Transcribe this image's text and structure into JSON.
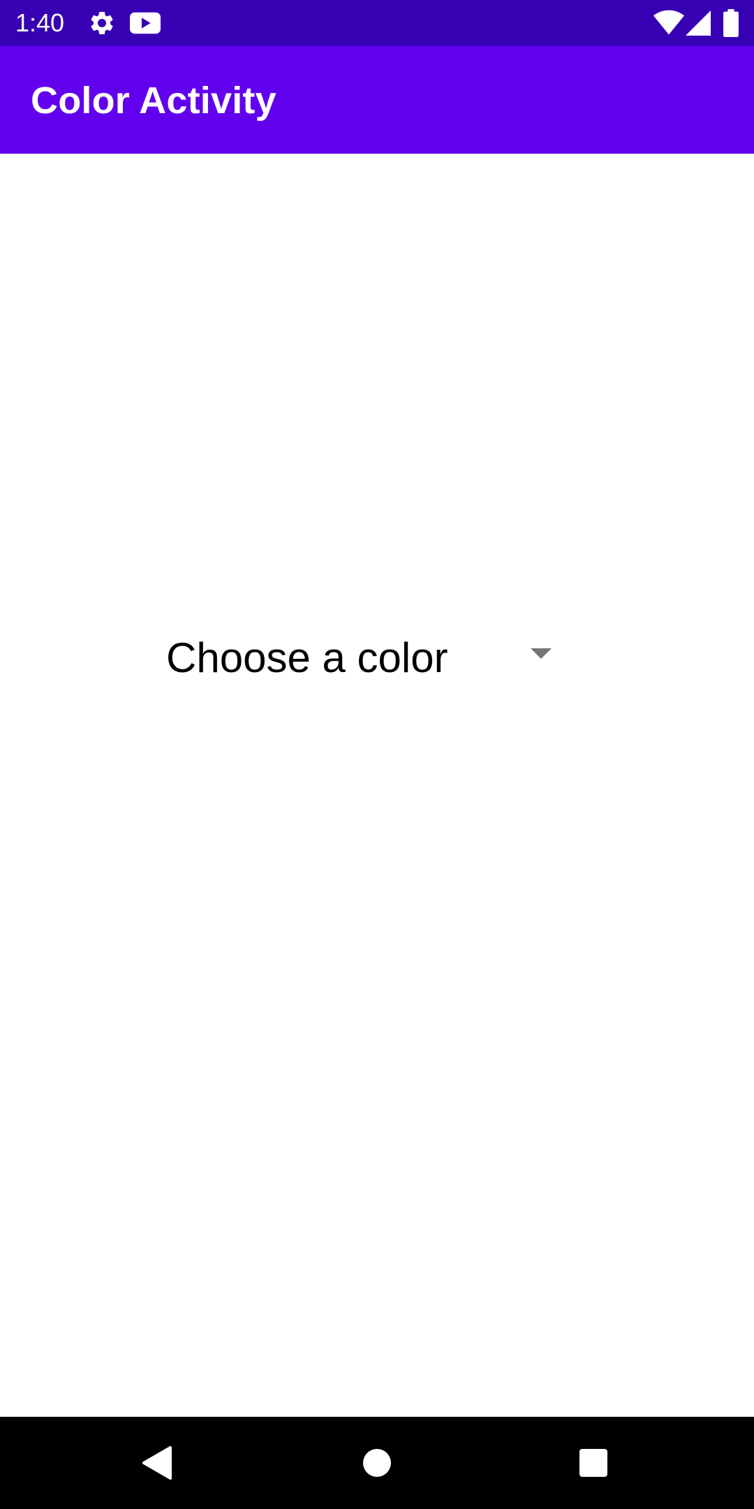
{
  "status_bar": {
    "time": "1:40",
    "icons": [
      "gear-icon",
      "youtube-icon",
      "wifi-icon",
      "cell-signal-icon",
      "battery-icon"
    ],
    "background": "#3700b3"
  },
  "app_bar": {
    "title": "Color Activity",
    "background": "#6200ee"
  },
  "spinner": {
    "selected_value": "Choose a color",
    "icon": "dropdown-arrow-icon"
  },
  "nav_bar": {
    "buttons": [
      "back-icon",
      "home-icon",
      "recents-icon"
    ],
    "background": "#000000"
  }
}
